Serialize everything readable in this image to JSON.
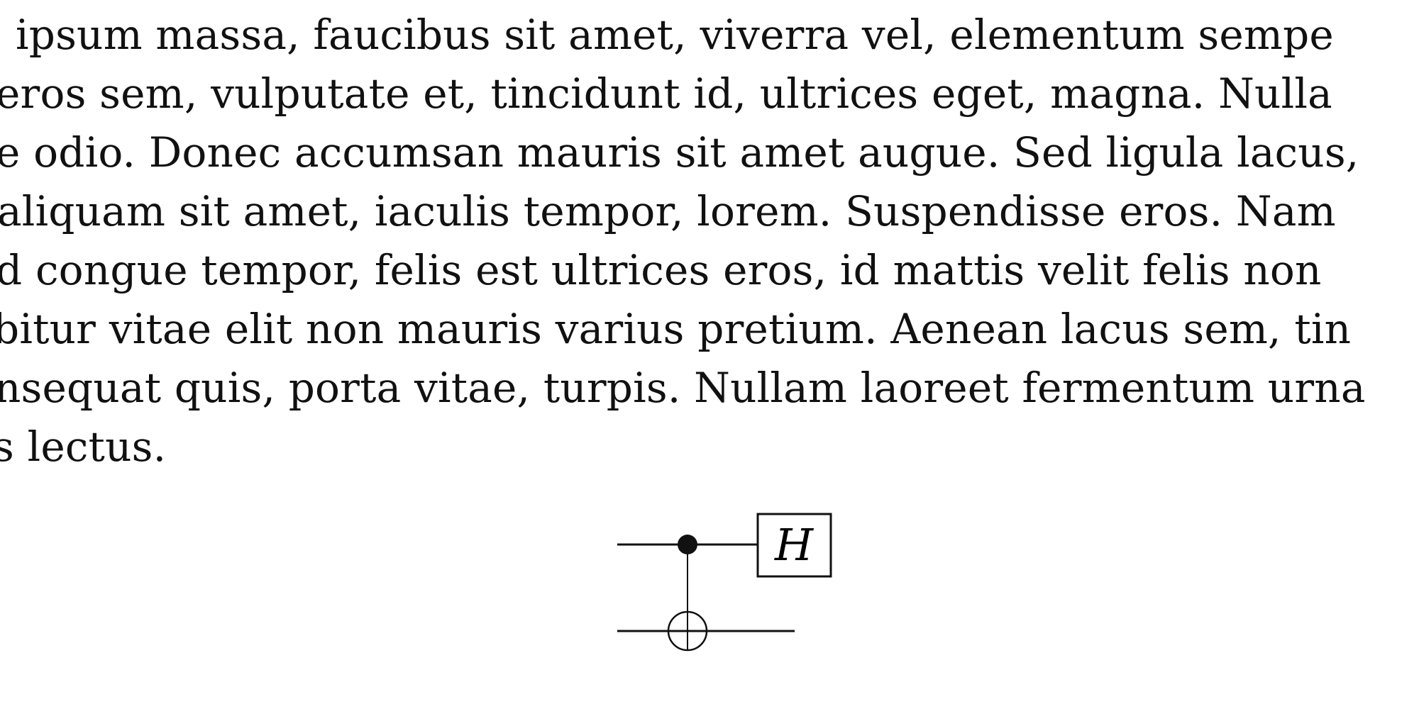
{
  "document": {
    "paragraph_lines": [
      "ipsum massa, faucibus sit amet, viverra vel, elementum sempe",
      "eros sem, vulputate et, tincidunt id, ultrices eget, magna. Nulla",
      "e odio. Donec accumsan mauris sit amet augue. Sed ligula lacus,",
      "aliquam sit amet, iaculis tempor, lorem. Suspendisse eros. Nam",
      "d congue tempor, felis est ultrices eros, id mattis velit felis non",
      "bitur vitae elit non mauris varius pretium. Aenean lacus sem, tin",
      "nsequat quis, porta vitae, turpis. Nullam laoreet fermentum urna",
      "s lectus."
    ]
  },
  "circuit": {
    "gate_label": "H"
  }
}
